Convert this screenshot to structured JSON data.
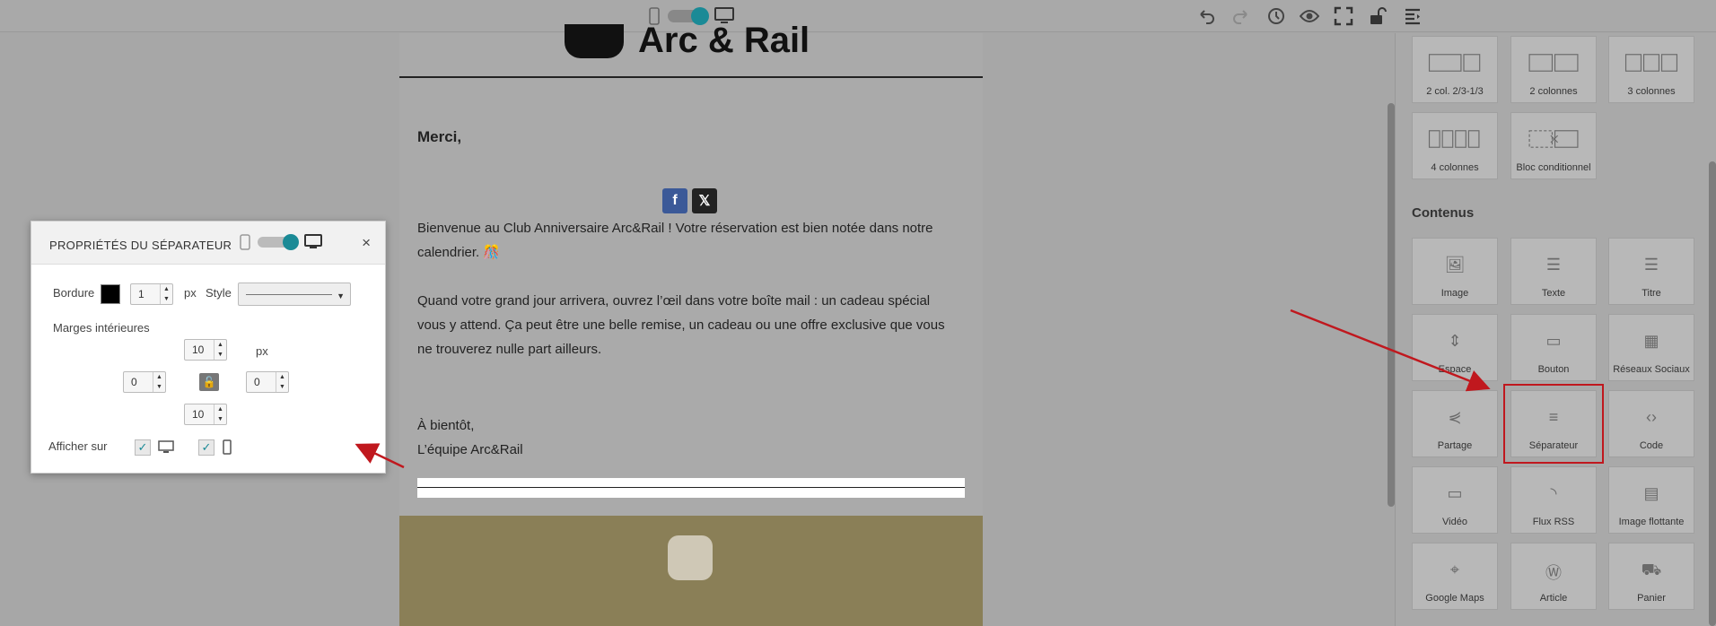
{
  "email": {
    "header_title": "Arc & Rail",
    "greeting": "Merci,",
    "paragraph1": "Bienvenue au Club Anniversaire Arc&Rail ! Votre réservation est bien notée dans notre calendrier. 🎊",
    "paragraph2": "Quand votre grand jour arrivera, ouvrez l’œil dans votre boîte mail : un cadeau spécial vous y attend. Ça peut être une belle remise, un cadeau ou une offre exclusive que vous ne trouverez nulle part ailleurs.",
    "closing1": "À bientôt,",
    "closing2": "L’équipe Arc&Rail",
    "social": [
      "f",
      "𝕏"
    ]
  },
  "panel": {
    "title": "PROPRIÉTÉS DU SÉPARATEUR",
    "close": "×",
    "border_label": "Bordure",
    "border_width": "1",
    "border_unit": "px",
    "style_label": "Style",
    "padding_label": "Marges intérieures",
    "padding_unit": "px",
    "padding_top": "10",
    "padding_left": "0",
    "padding_right": "0",
    "padding_bottom": "10",
    "show_on_label": "Afficher sur"
  },
  "sidebar": {
    "layout_tiles": [
      {
        "label": "2 col. 2/3-1/3"
      },
      {
        "label": "2 colonnes"
      },
      {
        "label": "3 colonnes"
      },
      {
        "label": "4 colonnes"
      },
      {
        "label": "Bloc conditionnel"
      }
    ],
    "section_title": "Contenus",
    "content_tiles": [
      {
        "label": "Image",
        "icon": "image-icon"
      },
      {
        "label": "Texte",
        "icon": "text-icon"
      },
      {
        "label": "Titre",
        "icon": "title-icon"
      },
      {
        "label": "Espace",
        "icon": "space-icon"
      },
      {
        "label": "Bouton",
        "icon": "button-icon"
      },
      {
        "label": "Réseaux Sociaux",
        "icon": "social-icon"
      },
      {
        "label": "Partage",
        "icon": "share-icon"
      },
      {
        "label": "Séparateur",
        "icon": "separator-icon"
      },
      {
        "label": "Code",
        "icon": "code-icon"
      },
      {
        "label": "Vidéo",
        "icon": "video-icon"
      },
      {
        "label": "Flux RSS",
        "icon": "rss-icon"
      },
      {
        "label": "Image flottante",
        "icon": "floating-image-icon"
      },
      {
        "label": "Google Maps",
        "icon": "map-pin-icon"
      },
      {
        "label": "Article",
        "icon": "wordpress-icon"
      },
      {
        "label": "Panier",
        "icon": "cart-icon"
      }
    ]
  },
  "colors": {
    "accent": "#1a8a96",
    "highlight": "#c0181e",
    "footer": "#8a7f57"
  }
}
